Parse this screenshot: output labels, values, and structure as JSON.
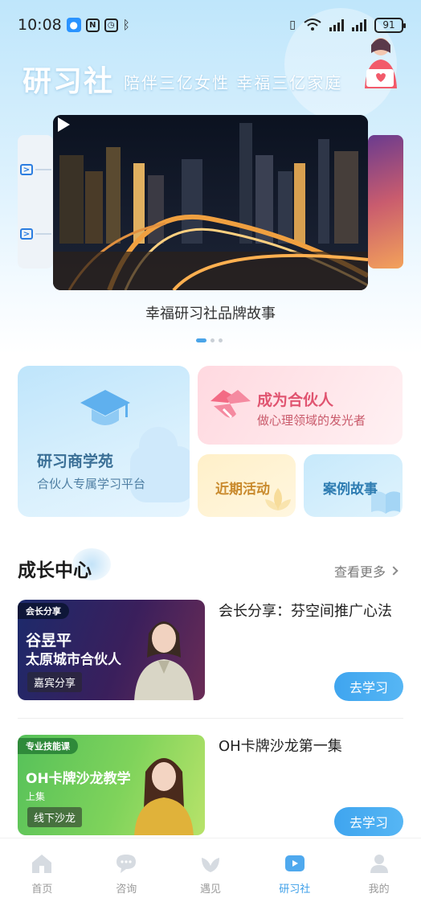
{
  "status_bar": {
    "time": "10:08",
    "battery": "91",
    "left_icons": [
      "message-icon",
      "nfc-icon",
      "alarm-icon",
      "bluetooth-icon"
    ],
    "right_icons": [
      "vibrate-icon",
      "wifi-icon",
      "signal-icon",
      "signal-icon"
    ]
  },
  "header": {
    "logo": "研习社",
    "slogan": "陪伴三亿女性 幸福三亿家庭"
  },
  "carousel": {
    "caption": "幸福研习社品牌故事",
    "slide_count": 3,
    "active_index": 0
  },
  "tiles": {
    "academy": {
      "title": "研习商学苑",
      "subtitle": "合伙人专属学习平台"
    },
    "partner": {
      "title": "成为合伙人",
      "subtitle": "做心理领域的发光者"
    },
    "events": {
      "title": "近期活动"
    },
    "cases": {
      "title": "案例故事"
    }
  },
  "growth_center": {
    "title": "成长中心",
    "see_more": "查看更多",
    "courses": [
      {
        "title": "会长分享：芬空间推广心法",
        "thumb_tag": "会长分享",
        "thumb_name": "谷昱平",
        "thumb_role": "太原城市合伙人",
        "thumb_badge": "嘉宾分享",
        "button": "去学习"
      },
      {
        "title": "OH卡牌沙龙第一集",
        "thumb_tag": "专业技能课",
        "thumb_name": "OH卡牌沙龙教学",
        "thumb_sub": "上集",
        "thumb_badge": "线下沙龙",
        "button": "去学习"
      }
    ]
  },
  "bottom_nav": {
    "items": [
      {
        "label": "首页",
        "icon": "home-icon"
      },
      {
        "label": "咨询",
        "icon": "chat-icon"
      },
      {
        "label": "遇见",
        "icon": "meet-icon"
      },
      {
        "label": "研习社",
        "icon": "study-icon"
      },
      {
        "label": "我的",
        "icon": "profile-icon"
      }
    ],
    "active": "研习社"
  },
  "colors": {
    "accent": "#3b9ee8",
    "hero_bg": "#bfe6fb",
    "partner_pink": "#e05470",
    "events_gold": "#c98a2d",
    "cases_blue": "#2f7db2"
  }
}
